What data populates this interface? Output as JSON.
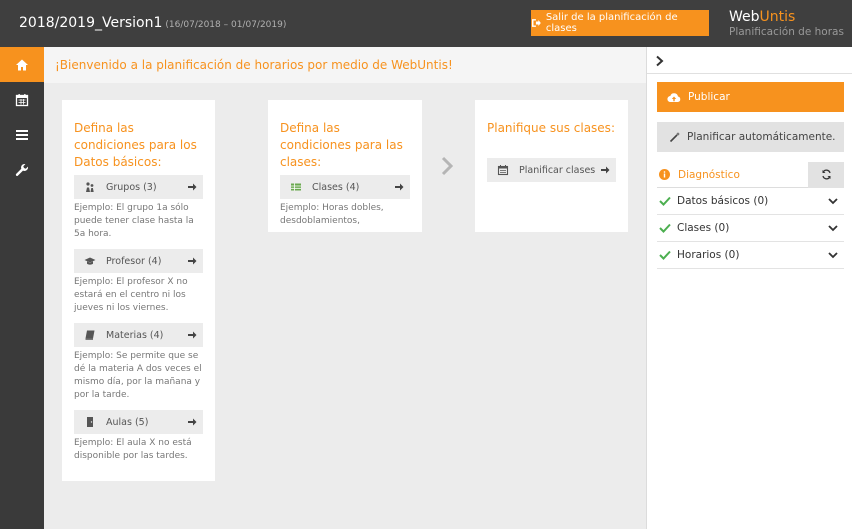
{
  "header": {
    "title": "2018/2019_Version1",
    "dates": "(16/07/2018 – 01/07/2019)",
    "exit_label": "Salir de la planificación de clases",
    "brand_a": "Web",
    "brand_b": "Untis",
    "brand_sub": "Planificación de horas"
  },
  "sidebar": {
    "items": [
      {
        "icon": "home-icon",
        "active": true
      },
      {
        "icon": "calendar-icon",
        "active": false
      },
      {
        "icon": "list-icon",
        "active": false
      },
      {
        "icon": "wrench-icon",
        "active": false
      }
    ]
  },
  "welcome": "¡Bienvenido a la planificación de horarios por medio de WebUntis!",
  "cards": {
    "basic": {
      "title": "Defina las condiciones para los Datos básicos:",
      "items": [
        {
          "label": "Grupos (3)",
          "note": "Ejemplo: El grupo 1a sólo puede tener clase hasta la 5a hora."
        },
        {
          "label": "Profesor (4)",
          "note": "Ejemplo: El profesor X no estará en el centro ni los jueves ni los viernes."
        },
        {
          "label": "Materias (4)",
          "note": "Ejemplo: Se permite que se dé la materia A dos veces el mismo día, por la mañana y por la tarde."
        },
        {
          "label": "Aulas (5)",
          "note": "Ejemplo: El aula X no está disponible por las tardes."
        }
      ]
    },
    "classes": {
      "title": "Defina las condiciones para las clases:",
      "button": "Clases (4)",
      "note": "Ejemplo: Horas dobles, desdoblamientos,"
    },
    "plan": {
      "title": "Planifique sus clases:",
      "button": "Planificar clases"
    }
  },
  "right_panel": {
    "publish": "Publicar",
    "auto": "Planificar automáticamente.",
    "diagnostic": "Diagnóstico",
    "diag_items": [
      {
        "label": "Datos básicos (0)"
      },
      {
        "label": "Clases (0)"
      },
      {
        "label": "Horarios (0)"
      }
    ]
  },
  "colors": {
    "accent": "#f7921e",
    "topbar": "#3f3f3f",
    "sidebar": "#3a3a3a",
    "check": "#4caf50"
  }
}
